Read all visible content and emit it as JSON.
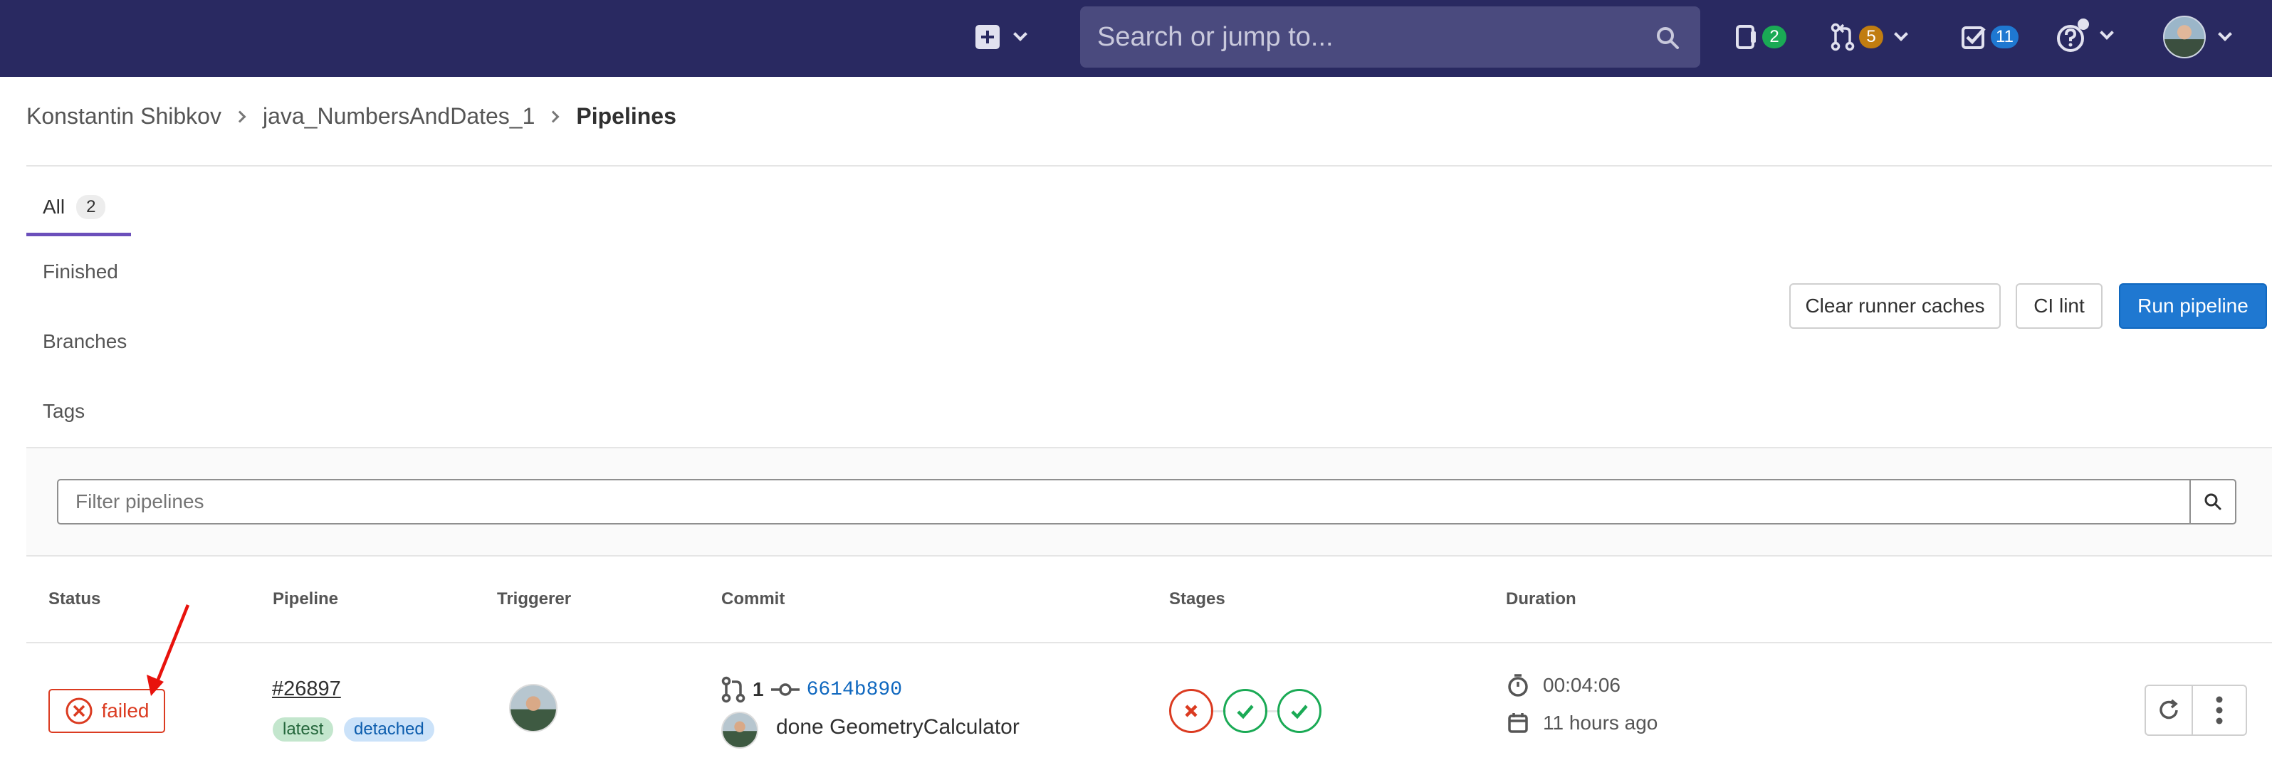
{
  "colors": {
    "nav_bg": "#292961",
    "primary": "#1f78d1",
    "failed": "#db3b21",
    "success": "#1aaa55",
    "tab_active": "#6b4fbb"
  },
  "topnav": {
    "new_icon": "plus-square-icon",
    "search": {
      "placeholder": "Search or jump to..."
    },
    "issues_count": "2",
    "merge_requests_count": "5",
    "todos_count": "11",
    "help_icon": "question-circle-icon",
    "user_icon": "avatar"
  },
  "breadcrumb": {
    "items": [
      "Konstantin Shibkov",
      "java_NumbersAndDates_1",
      "Pipelines"
    ]
  },
  "tabs": [
    {
      "label": "All",
      "count": "2",
      "active": true
    },
    {
      "label": "Finished"
    },
    {
      "label": "Branches"
    },
    {
      "label": "Tags"
    }
  ],
  "actions": {
    "clear_cache": "Clear runner caches",
    "ci_lint": "CI lint",
    "run_pipeline": "Run pipeline"
  },
  "filter": {
    "placeholder": "Filter pipelines"
  },
  "table": {
    "headers": [
      "Status",
      "Pipeline",
      "Triggerer",
      "Commit",
      "Stages",
      "Duration"
    ],
    "rows": [
      {
        "status": "failed",
        "pipeline_id": "#26897",
        "labels": [
          "latest",
          "detached"
        ],
        "mr_count": "1",
        "sha": "6614b890",
        "message": "done GeometryCalculator",
        "stages": [
          "failed",
          "success",
          "success"
        ],
        "duration": "00:04:06",
        "finished": "11 hours ago"
      }
    ]
  }
}
